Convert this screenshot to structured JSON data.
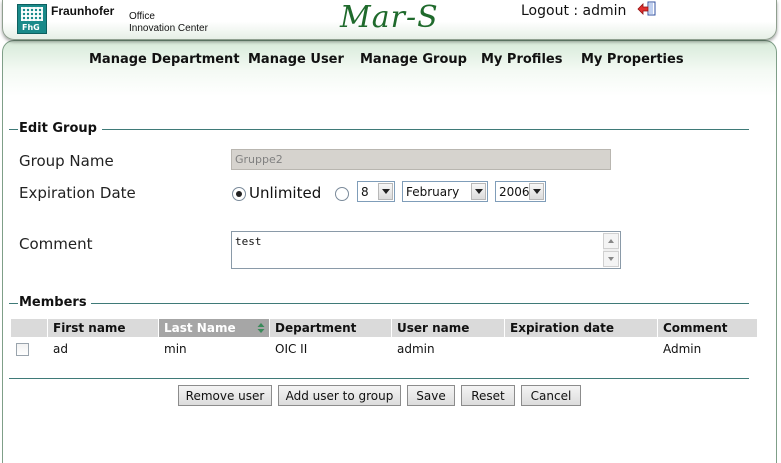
{
  "header": {
    "logo_text": "FhG",
    "brand_name": "Fraunhofer",
    "brand_sub1": "Office",
    "brand_sub2": "Innovation Center",
    "app_title": "Mar-S",
    "logout_text": "Logout : admin"
  },
  "nav": {
    "items": [
      "Manage Department",
      "Manage User",
      "Manage Group",
      "My Profiles",
      "My Properties"
    ]
  },
  "edit_group": {
    "legend": "Edit Group",
    "group_name_label": "Group Name",
    "group_name_value": "Gruppe2",
    "expiration_label": "Expiration Date",
    "unlimited_label": "Unlimited",
    "unlimited_checked": true,
    "day_value": "8",
    "month_value": "February",
    "year_value": "2006",
    "comment_label": "Comment",
    "comment_value": "test"
  },
  "members": {
    "legend": "Members",
    "columns": [
      "First name",
      "Last Name",
      "Department",
      "User name",
      "Expiration date",
      "Comment"
    ],
    "sorted_column": "Last Name",
    "rows": [
      {
        "first_name": "ad",
        "last_name": "min",
        "department": "OIC II",
        "user_name": "admin",
        "expiration_date": "",
        "comment": "Admin",
        "selected": false
      }
    ]
  },
  "buttons": {
    "remove_user": "Remove user",
    "add_user": "Add user to group",
    "save": "Save",
    "reset": "Reset",
    "cancel": "Cancel"
  },
  "colors": {
    "title_green": "#1f6a2c",
    "rule_teal": "#3f7a78",
    "header_active": "#a6a6a6",
    "header_bg": "#dadada"
  }
}
